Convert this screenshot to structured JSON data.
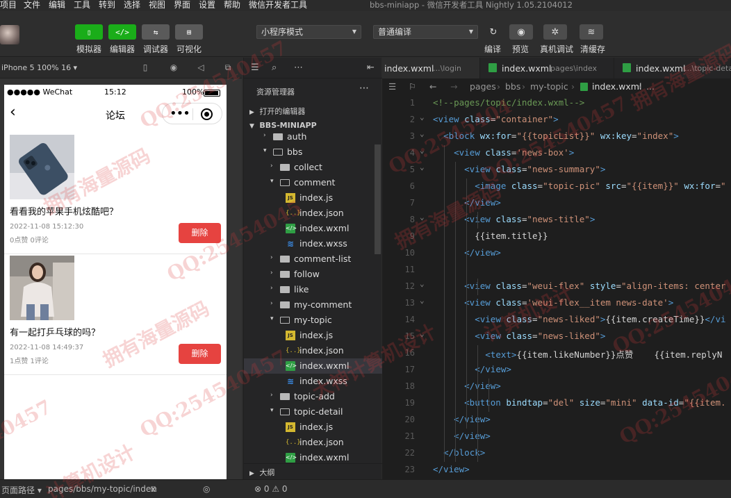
{
  "menubar": {
    "items": [
      "项目",
      "文件",
      "编辑",
      "工具",
      "转到",
      "选择",
      "视图",
      "界面",
      "设置",
      "帮助",
      "微信开发者工具"
    ],
    "window_title": "bbs-miniapp - 微信开发者工具 Nightly 1.05.2104012"
  },
  "toolbar": {
    "left_buttons": [
      {
        "label": "模拟器",
        "icon": "phone-icon",
        "glyph": "▯"
      },
      {
        "label": "编辑器",
        "icon": "code-icon",
        "glyph": "</>"
      },
      {
        "label": "调试器",
        "icon": "debug-icon",
        "glyph": "⇆"
      },
      {
        "label": "可视化",
        "icon": "visual-icon",
        "glyph": "⊞"
      }
    ],
    "mode_select": "小程序模式",
    "compile_select": "普通编译",
    "right_buttons": [
      {
        "label": "编译",
        "icon": "refresh-icon",
        "glyph": "↻"
      },
      {
        "label": "预览",
        "icon": "eye-icon",
        "glyph": "◉"
      },
      {
        "label": "真机调试",
        "icon": "bug-icon",
        "glyph": "✲"
      },
      {
        "label": "清缓存",
        "icon": "layers-icon",
        "glyph": "≋"
      }
    ]
  },
  "simulator": {
    "device": "iPhone 5 100% 16 ▾",
    "status": {
      "carrier": "●●●●● WeChat",
      "time": "15:12",
      "battery": "100%"
    },
    "nav_title": "论坛",
    "posts": [
      {
        "title": "看看我的苹果手机炫酷吧？",
        "date": "2022-11-08 15:12:30",
        "meta": "0点赞 0评论",
        "delete_label": "删除"
      },
      {
        "title": "有一起打乒乓球的吗？",
        "date": "2022-11-08 14:49:37",
        "meta": "1点赞 1评论",
        "delete_label": "删除"
      }
    ]
  },
  "explorer": {
    "header": "资源管理器",
    "open_editors": "打开的编辑器",
    "project": "BBS-MINIAPP",
    "outline": "大纲",
    "tree": [
      {
        "name": "auth",
        "type": "folder",
        "indent": 1,
        "open": false
      },
      {
        "name": "bbs",
        "type": "folder",
        "indent": 1,
        "open": true
      },
      {
        "name": "collect",
        "type": "folder",
        "indent": 2,
        "open": false
      },
      {
        "name": "comment",
        "type": "folder",
        "indent": 2,
        "open": true
      },
      {
        "name": "index.js",
        "type": "js",
        "indent": 3
      },
      {
        "name": "index.json",
        "type": "json",
        "indent": 3
      },
      {
        "name": "index.wxml",
        "type": "wxml",
        "indent": 3
      },
      {
        "name": "index.wxss",
        "type": "wxss",
        "indent": 3
      },
      {
        "name": "comment-list",
        "type": "folder",
        "indent": 2,
        "open": false
      },
      {
        "name": "follow",
        "type": "folder",
        "indent": 2,
        "open": false
      },
      {
        "name": "like",
        "type": "folder",
        "indent": 2,
        "open": false
      },
      {
        "name": "my-comment",
        "type": "folder",
        "indent": 2,
        "open": false
      },
      {
        "name": "my-topic",
        "type": "folder",
        "indent": 2,
        "open": true
      },
      {
        "name": "index.js",
        "type": "js",
        "indent": 3
      },
      {
        "name": "index.json",
        "type": "json",
        "indent": 3
      },
      {
        "name": "index.wxml",
        "type": "wxml",
        "indent": 3,
        "selected": true
      },
      {
        "name": "index.wxss",
        "type": "wxss",
        "indent": 3
      },
      {
        "name": "topic-add",
        "type": "folder",
        "indent": 2,
        "open": false
      },
      {
        "name": "topic-detail",
        "type": "folder",
        "indent": 2,
        "open": true
      },
      {
        "name": "index.js",
        "type": "js",
        "indent": 3
      },
      {
        "name": "index.json",
        "type": "json",
        "indent": 3
      },
      {
        "name": "index.wxml",
        "type": "wxml",
        "indent": 3
      }
    ]
  },
  "editor": {
    "tabs": [
      {
        "name": "index.wxml",
        "path": "...\\login",
        "icon": false
      },
      {
        "name": "index.wxml",
        "path": "pages\\index",
        "icon": true
      },
      {
        "name": "index.wxml",
        "path": "...\\topic-deta",
        "icon": true
      }
    ],
    "breadcrumbs": [
      "pages",
      "bbs",
      "my-topic",
      "index.wxml",
      "..."
    ],
    "lines": [
      {
        "n": "1",
        "fold": false,
        "html": "<span class=\"c\">&lt;!--pages/topic/index.wxml--&gt;</span>"
      },
      {
        "n": "2",
        "fold": true,
        "html": "<span class=\"t\">&lt;view</span> <span class=\"a\">class</span><span class=\"p\">=</span><span class=\"s\">\"container\"</span><span class=\"t\">&gt;</span>"
      },
      {
        "n": "3",
        "fold": true,
        "html": "  <span class=\"t\">&lt;block</span> <span class=\"a\">wx:for</span><span class=\"p\">=</span><span class=\"s\">\"{{topicList}}\"</span> <span class=\"a\">wx:key</span><span class=\"p\">=</span><span class=\"s\">\"index\"</span><span class=\"t\">&gt;</span>"
      },
      {
        "n": "4",
        "fold": true,
        "html": "    <span class=\"t\">&lt;view</span> <span class=\"a\">class</span><span class=\"p\">=</span><span class=\"s\">'news-box'</span><span class=\"t\">&gt;</span>"
      },
      {
        "n": "5",
        "fold": true,
        "html": "      <span class=\"t\">&lt;view</span> <span class=\"a\">class</span><span class=\"p\">=</span><span class=\"s\">\"news-summary\"</span><span class=\"t\">&gt;</span>"
      },
      {
        "n": "6",
        "fold": false,
        "html": "        <span class=\"t\">&lt;image</span> <span class=\"a\">class</span><span class=\"p\">=</span><span class=\"s\">\"topic-pic\"</span> <span class=\"a\">src</span><span class=\"p\">=</span><span class=\"s\">\"{{item}}\"</span> <span class=\"a\">wx:for</span><span class=\"p\">=</span><span class=\"s\">\"</span>"
      },
      {
        "n": "7",
        "fold": false,
        "html": "      <span class=\"t\">&lt;/view&gt;</span>"
      },
      {
        "n": "8",
        "fold": true,
        "html": "      <span class=\"t\">&lt;view</span> <span class=\"a\">class</span><span class=\"p\">=</span><span class=\"s\">\"news-title\"</span><span class=\"t\">&gt;</span>"
      },
      {
        "n": "9",
        "fold": false,
        "html": "        <span class=\"p\">{{item.title}}</span>"
      },
      {
        "n": "10",
        "fold": false,
        "html": "      <span class=\"t\">&lt;/view&gt;</span>"
      },
      {
        "n": "11",
        "fold": false,
        "html": ""
      },
      {
        "n": "12",
        "fold": true,
        "html": "      <span class=\"t\">&lt;view</span> <span class=\"a\">class</span><span class=\"p\">=</span><span class=\"s\">\"weui-flex\"</span> <span class=\"a\">style</span><span class=\"p\">=</span><span class=\"s\">\"align-items: center</span>"
      },
      {
        "n": "13",
        "fold": true,
        "html": "      <span class=\"t\">&lt;view</span> <span class=\"a\">class</span><span class=\"p\">=</span><span class=\"s\">'weui-flex__item news-date'</span><span class=\"t\">&gt;</span>"
      },
      {
        "n": "14",
        "fold": false,
        "html": "        <span class=\"t\">&lt;view</span> <span class=\"a\">class</span><span class=\"p\">=</span><span class=\"s\">\"news-liked\"</span><span class=\"t\">&gt;</span><span class=\"p\">{{item.createTime}}</span><span class=\"t\">&lt;/vi</span>"
      },
      {
        "n": "15",
        "fold": true,
        "html": "        <span class=\"t\">&lt;view</span> <span class=\"a\">class</span><span class=\"p\">=</span><span class=\"s\">\"news-liked\"</span><span class=\"t\">&gt;</span>"
      },
      {
        "n": "16",
        "fold": false,
        "html": "          <span class=\"t\">&lt;text&gt;</span><span class=\"p\">{{item.likeNumber}}点赞    {{item.replyN</span>"
      },
      {
        "n": "17",
        "fold": false,
        "html": "        <span class=\"t\">&lt;/view&gt;</span>"
      },
      {
        "n": "18",
        "fold": false,
        "html": "      <span class=\"t\">&lt;/view&gt;</span>"
      },
      {
        "n": "19",
        "fold": false,
        "html": "      <span class=\"t\">&lt;button</span> <span class=\"a\">bindtap</span><span class=\"p\">=</span><span class=\"s\">\"del\"</span> <span class=\"a\">size</span><span class=\"p\">=</span><span class=\"s\">\"mini\"</span> <span class=\"a\">data-id</span><span class=\"p\">=</span><span class=\"s\">\"{{item.</span>"
      },
      {
        "n": "20",
        "fold": false,
        "html": "    <span class=\"t\">&lt;/view&gt;</span>"
      },
      {
        "n": "21",
        "fold": false,
        "html": "    <span class=\"t\">&lt;/view&gt;</span>"
      },
      {
        "n": "22",
        "fold": false,
        "html": "  <span class=\"t\">&lt;/block&gt;</span>"
      },
      {
        "n": "23",
        "fold": false,
        "html": "<span class=\"t\">&lt;/view&gt;</span>"
      }
    ]
  },
  "bottombar": {
    "path_label": "页面路径 ▾",
    "path": "pages/bbs/my-topic/index",
    "problems": "⊗ 0 ⚠ 0"
  },
  "watermarks": [
    "QQ:254540457",
    "拥有海量源码",
    "大神计算机设计",
    "QQ:25454045",
    "拥有海量源码",
    "QQ:254540457",
    "计算机设计",
    "QQ:254540457",
    "拥有海量源码",
    "QQ:254540457",
    "40457",
    "QQ:2545404",
    "拥有海量源码",
    "QQ:254540457",
    "计算机设计"
  ]
}
